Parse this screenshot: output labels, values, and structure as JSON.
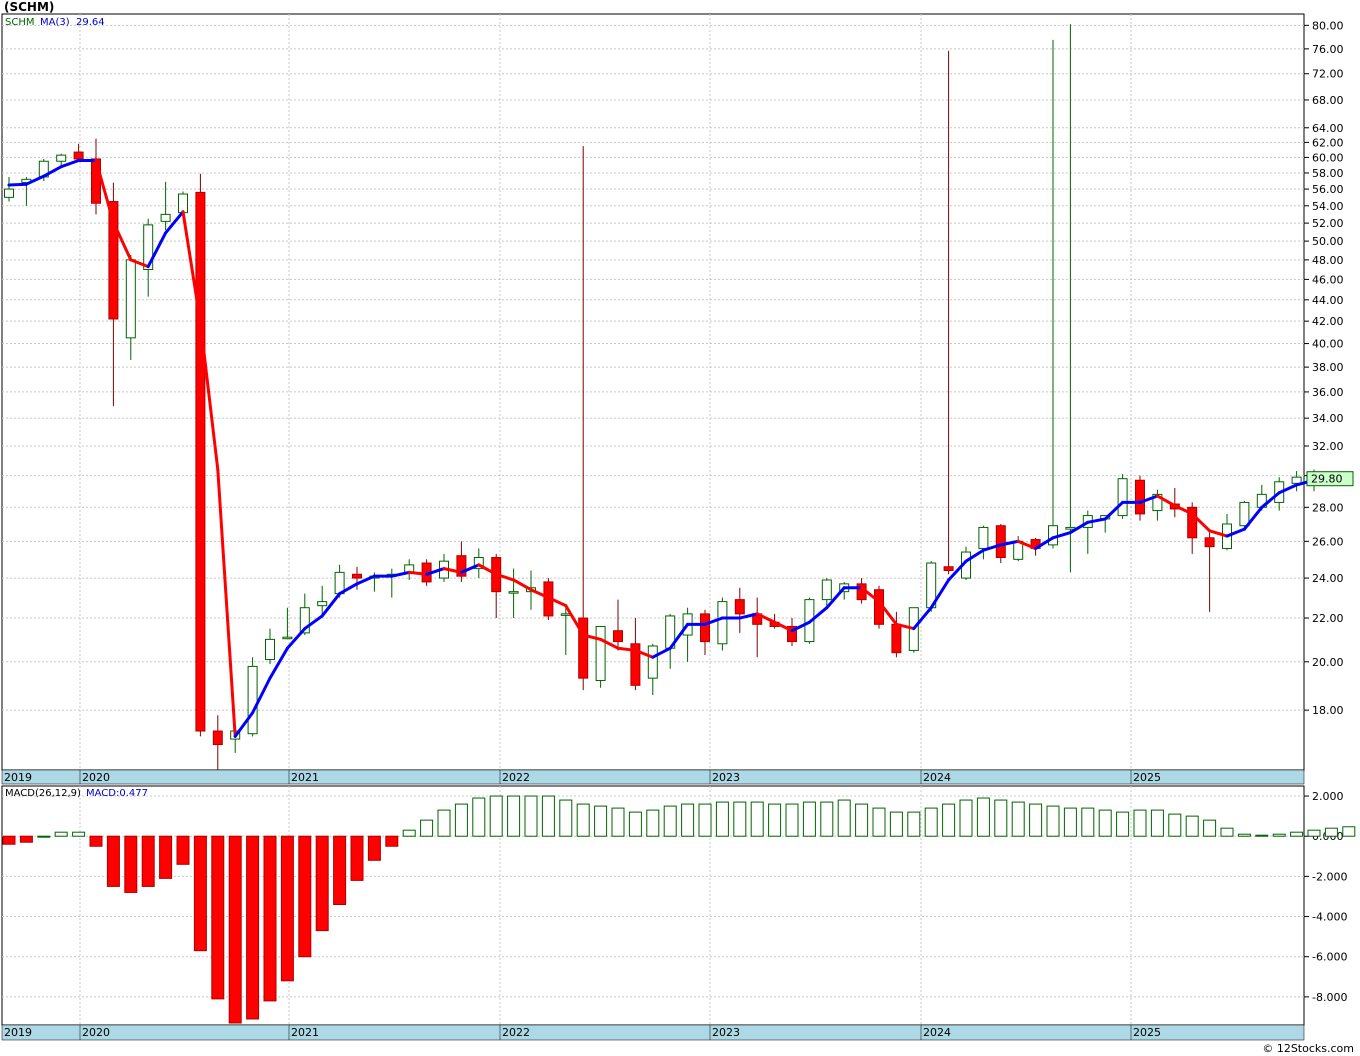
{
  "title": "(SCHM)",
  "credit": "© 12Stocks.com",
  "legend": {
    "symbol": "SCHM",
    "ma_label": "MA(3)",
    "ma_value": "29.64"
  },
  "macd_legend": {
    "label": "MACD(26,12,9)",
    "value": "MACD:0.477"
  },
  "last_price_label": "29.80",
  "colors": {
    "up_candle": "#006400",
    "down_candle": "#ff0000",
    "ma_up": "#0000ff",
    "ma_down": "#ff0000",
    "axis_band": "#add8e6",
    "grid": "#c8c8c8"
  },
  "chart_data": [
    {
      "type": "candlestick",
      "series_name": "SCHM",
      "scale": "log",
      "ylim": [
        15.8,
        82
      ],
      "y_ticks": [
        "80.00",
        "76.00",
        "72.00",
        "68.00",
        "64.00",
        "62.00",
        "60.00",
        "58.00",
        "56.00",
        "54.00",
        "52.00",
        "50.00",
        "48.00",
        "46.00",
        "44.00",
        "42.00",
        "40.00",
        "38.00",
        "36.00",
        "34.00",
        "32.00",
        "30.00",
        "28.00",
        "26.00",
        "24.00",
        "22.00",
        "20.00",
        "18.00"
      ],
      "x_labels": [
        "2019",
        "2020",
        "2021",
        "2022",
        "2023",
        "2024",
        "2025"
      ],
      "x_ticks": [
        "2020",
        "2021",
        "2022",
        "2023",
        "2024",
        "2025"
      ],
      "candles": [
        {
          "o": 55.0,
          "h": 57.5,
          "l": 54.5,
          "c": 56.0
        },
        {
          "o": 56.8,
          "h": 57.5,
          "l": 54.0,
          "c": 57.2
        },
        {
          "o": 57.5,
          "h": 59.8,
          "l": 57.0,
          "c": 59.5
        },
        {
          "o": 59.5,
          "h": 60.5,
          "l": 59.0,
          "c": 60.3
        },
        {
          "o": 60.7,
          "h": 61.8,
          "l": 59.5,
          "c": 59.8
        },
        {
          "o": 59.8,
          "h": 62.5,
          "l": 53.0,
          "c": 54.3
        },
        {
          "o": 54.5,
          "h": 56.8,
          "l": 34.9,
          "c": 42.2
        },
        {
          "o": 40.5,
          "h": 48.5,
          "l": 38.6,
          "c": 48.0
        },
        {
          "o": 47.0,
          "h": 52.5,
          "l": 44.3,
          "c": 51.8
        },
        {
          "o": 52.2,
          "h": 56.9,
          "l": 51.2,
          "c": 53.0
        },
        {
          "o": 53.2,
          "h": 55.7,
          "l": 52.5,
          "c": 55.4
        },
        {
          "o": 55.6,
          "h": 57.9,
          "l": 17.0,
          "c": 17.2
        },
        {
          "o": 17.2,
          "h": 17.8,
          "l": 15.8,
          "c": 16.7
        },
        {
          "o": 16.9,
          "h": 17.3,
          "l": 16.4,
          "c": 17.2
        },
        {
          "o": 17.1,
          "h": 20.2,
          "l": 17.0,
          "c": 19.8
        },
        {
          "o": 20.1,
          "h": 21.5,
          "l": 19.9,
          "c": 21.0
        },
        {
          "o": 21.1,
          "h": 22.5,
          "l": 21.0,
          "c": 21.1
        },
        {
          "o": 21.3,
          "h": 23.2,
          "l": 21.2,
          "c": 22.5
        },
        {
          "o": 22.6,
          "h": 23.6,
          "l": 22.1,
          "c": 22.8
        },
        {
          "o": 23.2,
          "h": 24.7,
          "l": 23.0,
          "c": 24.3
        },
        {
          "o": 24.2,
          "h": 24.6,
          "l": 23.4,
          "c": 24.0
        },
        {
          "o": 24.0,
          "h": 24.3,
          "l": 23.3,
          "c": 24.1
        },
        {
          "o": 24.1,
          "h": 24.5,
          "l": 23.0,
          "c": 24.2
        },
        {
          "o": 24.3,
          "h": 25.0,
          "l": 23.9,
          "c": 24.7
        },
        {
          "o": 24.8,
          "h": 25.0,
          "l": 23.6,
          "c": 23.8
        },
        {
          "o": 24.0,
          "h": 25.3,
          "l": 23.8,
          "c": 24.9
        },
        {
          "o": 25.2,
          "h": 26.0,
          "l": 23.8,
          "c": 24.1
        },
        {
          "o": 24.5,
          "h": 25.6,
          "l": 24.0,
          "c": 25.1
        },
        {
          "o": 25.1,
          "h": 25.3,
          "l": 22.0,
          "c": 23.3
        },
        {
          "o": 23.3,
          "h": 24.5,
          "l": 22.0,
          "c": 23.3
        },
        {
          "o": 23.3,
          "h": 24.4,
          "l": 22.4,
          "c": 23.5
        },
        {
          "o": 23.8,
          "h": 24.0,
          "l": 21.9,
          "c": 22.1
        },
        {
          "o": 22.2,
          "h": 22.5,
          "l": 20.3,
          "c": 22.2
        },
        {
          "o": 22.0,
          "h": 61.5,
          "l": 18.8,
          "c": 19.3
        },
        {
          "o": 19.2,
          "h": 21.6,
          "l": 18.9,
          "c": 21.6
        },
        {
          "o": 21.4,
          "h": 22.9,
          "l": 20.5,
          "c": 20.9
        },
        {
          "o": 20.8,
          "h": 22.0,
          "l": 18.8,
          "c": 19.0
        },
        {
          "o": 19.3,
          "h": 20.8,
          "l": 18.6,
          "c": 20.7
        },
        {
          "o": 20.6,
          "h": 22.2,
          "l": 19.7,
          "c": 22.1
        },
        {
          "o": 21.2,
          "h": 22.5,
          "l": 20.0,
          "c": 22.2
        },
        {
          "o": 22.2,
          "h": 22.4,
          "l": 20.3,
          "c": 20.9
        },
        {
          "o": 20.8,
          "h": 23.0,
          "l": 20.5,
          "c": 22.8
        },
        {
          "o": 22.9,
          "h": 23.5,
          "l": 21.3,
          "c": 22.2
        },
        {
          "o": 22.2,
          "h": 23.0,
          "l": 20.2,
          "c": 21.7
        },
        {
          "o": 21.8,
          "h": 22.2,
          "l": 21.5,
          "c": 21.6
        },
        {
          "o": 21.6,
          "h": 22.0,
          "l": 20.7,
          "c": 20.9
        },
        {
          "o": 20.9,
          "h": 23.0,
          "l": 20.8,
          "c": 22.9
        },
        {
          "o": 22.9,
          "h": 24.0,
          "l": 22.5,
          "c": 23.9
        },
        {
          "o": 23.3,
          "h": 23.8,
          "l": 22.9,
          "c": 23.7
        },
        {
          "o": 23.7,
          "h": 24.0,
          "l": 22.7,
          "c": 22.9
        },
        {
          "o": 23.4,
          "h": 23.6,
          "l": 21.5,
          "c": 21.7
        },
        {
          "o": 21.7,
          "h": 22.3,
          "l": 20.2,
          "c": 20.4
        },
        {
          "o": 20.5,
          "h": 22.5,
          "l": 20.4,
          "c": 22.5
        },
        {
          "o": 22.5,
          "h": 24.9,
          "l": 22.3,
          "c": 24.8
        },
        {
          "o": 24.6,
          "h": 75.7,
          "l": 24.2,
          "c": 24.4
        },
        {
          "o": 24.0,
          "h": 25.7,
          "l": 23.9,
          "c": 25.4
        },
        {
          "o": 25.6,
          "h": 26.9,
          "l": 25.0,
          "c": 26.8
        },
        {
          "o": 26.9,
          "h": 27.0,
          "l": 24.8,
          "c": 25.1
        },
        {
          "o": 25.0,
          "h": 26.3,
          "l": 24.9,
          "c": 26.0
        },
        {
          "o": 26.1,
          "h": 26.2,
          "l": 25.2,
          "c": 25.6
        },
        {
          "o": 25.8,
          "h": 77.5,
          "l": 25.6,
          "c": 26.9
        },
        {
          "o": 26.7,
          "h": 80.2,
          "l": 24.3,
          "c": 26.8
        },
        {
          "o": 26.8,
          "h": 27.8,
          "l": 25.3,
          "c": 27.5
        },
        {
          "o": 27.3,
          "h": 27.5,
          "l": 26.5,
          "c": 27.5
        },
        {
          "o": 27.5,
          "h": 30.1,
          "l": 27.3,
          "c": 29.8
        },
        {
          "o": 29.7,
          "h": 30.0,
          "l": 27.2,
          "c": 27.6
        },
        {
          "o": 27.8,
          "h": 29.1,
          "l": 27.2,
          "c": 28.8
        },
        {
          "o": 28.2,
          "h": 29.2,
          "l": 27.4,
          "c": 27.9
        },
        {
          "o": 28.0,
          "h": 28.3,
          "l": 25.3,
          "c": 26.2
        },
        {
          "o": 26.2,
          "h": 26.5,
          "l": 22.3,
          "c": 25.7
        },
        {
          "o": 25.6,
          "h": 27.6,
          "l": 25.5,
          "c": 27.0
        },
        {
          "o": 26.9,
          "h": 28.4,
          "l": 26.7,
          "c": 28.3
        },
        {
          "o": 28.0,
          "h": 29.4,
          "l": 27.8,
          "c": 28.8
        },
        {
          "o": 28.3,
          "h": 29.9,
          "l": 27.8,
          "c": 29.6
        },
        {
          "o": 29.5,
          "h": 30.3,
          "l": 29.0,
          "c": 29.9
        },
        {
          "o": 29.5,
          "h": 30.4,
          "l": 29.0,
          "c": 29.8
        }
      ],
      "ma": [
        56.5,
        56.6,
        57.6,
        58.8,
        59.6,
        59.6,
        52.1,
        48.0,
        47.3,
        50.9,
        53.3,
        41.9,
        30.4,
        17.0,
        17.9,
        19.3,
        20.6,
        21.5,
        22.1,
        23.2,
        23.7,
        24.1,
        24.1,
        24.3,
        24.2,
        24.5,
        24.3,
        24.7,
        24.2,
        23.9,
        23.4,
        23.0,
        22.6,
        21.2,
        21.0,
        20.6,
        20.5,
        20.2,
        20.6,
        21.7,
        21.7,
        22.0,
        22.0,
        22.2,
        21.8,
        21.4,
        21.8,
        22.5,
        23.5,
        23.5,
        22.8,
        21.7,
        21.5,
        22.5,
        23.9,
        24.9,
        25.5,
        25.8,
        26.0,
        25.6,
        26.2,
        26.5,
        27.1,
        27.3,
        28.3,
        28.3,
        28.7,
        28.1,
        27.6,
        26.6,
        26.3,
        26.7,
        28.0,
        28.9,
        29.4,
        29.7
      ]
    },
    {
      "type": "bar",
      "series_name": "MACD(26,12,9)",
      "ylim": [
        -9.4,
        2.5
      ],
      "y_ticks": [
        "2.000",
        "0.000",
        "-2.000",
        "-4.000",
        "-6.000",
        "-8.000"
      ],
      "x_labels": [
        "2019",
        "2020",
        "2021",
        "2022",
        "2023",
        "2024",
        "2025"
      ],
      "values": [
        -0.4,
        -0.3,
        0,
        0.2,
        0.2,
        -0.5,
        -2.5,
        -2.8,
        -2.5,
        -2.1,
        -1.4,
        -5.7,
        -8.1,
        -9.3,
        -9.1,
        -8.2,
        -7.2,
        -6.0,
        -4.7,
        -3.4,
        -2.2,
        -1.2,
        -0.5,
        0.3,
        0.8,
        1.3,
        1.6,
        1.9,
        2.0,
        2.0,
        2.0,
        2.0,
        1.8,
        1.6,
        1.5,
        1.4,
        1.2,
        1.3,
        1.5,
        1.6,
        1.6,
        1.7,
        1.7,
        1.7,
        1.6,
        1.6,
        1.7,
        1.7,
        1.8,
        1.6,
        1.4,
        1.2,
        1.2,
        1.4,
        1.6,
        1.8,
        1.9,
        1.8,
        1.7,
        1.6,
        1.5,
        1.4,
        1.4,
        1.3,
        1.2,
        1.3,
        1.3,
        1.1,
        1.0,
        0.8,
        0.4,
        0.1,
        0.05,
        0.1,
        0.2,
        0.3,
        0.4,
        0.47
      ]
    }
  ]
}
